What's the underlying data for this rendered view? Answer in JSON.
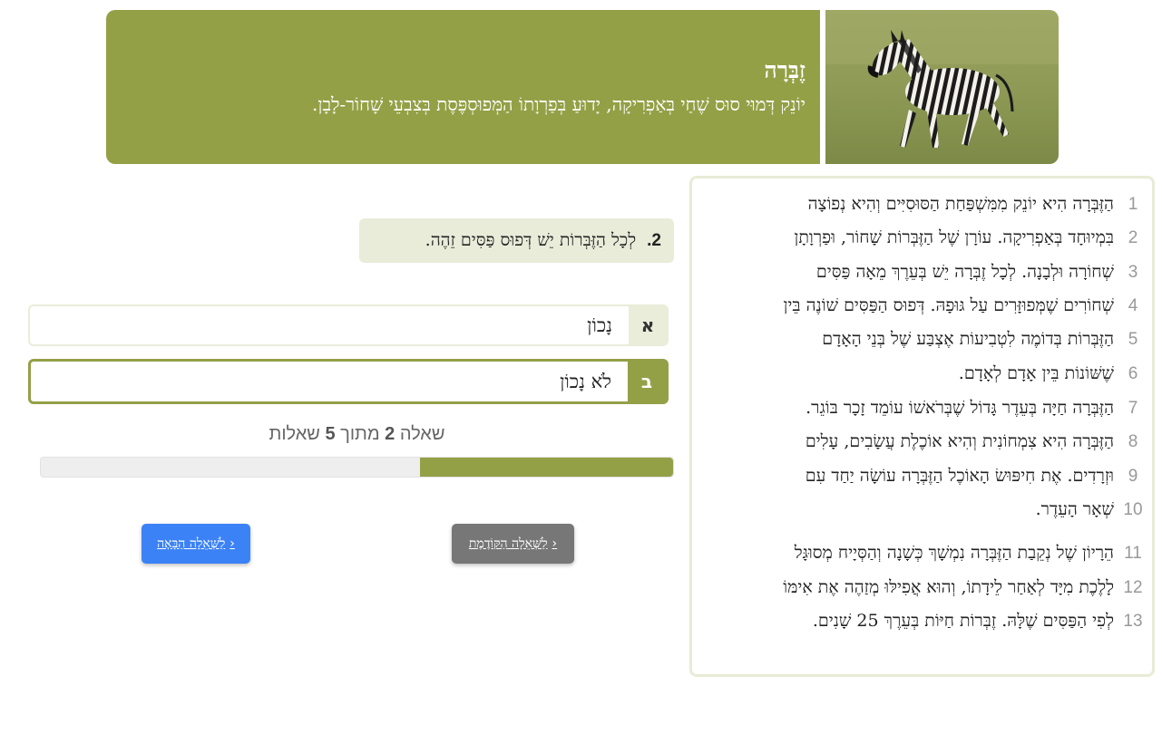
{
  "header": {
    "title": "זֶבְּרָה",
    "subtitle": "יוֹנֵק דְּמוּי סוּס שֶׁחַי בְּאַפְרִיקָה, יָדוּעַ בְּפַרְוָתוֹ הַמְּפוּסְפֶּסֶת בְּצִבְעֵי שָׁחוֹר-לָבָן.",
    "image_alt": "zebra-photo"
  },
  "passage": {
    "lines": [
      {
        "num": "1",
        "text": "הַזֶּבְּרָה הִיא יוֹנֵק מִמִּשְׁפַּחַת הַסּוּסִיִּים וְהִיא נְפוֹצָה"
      },
      {
        "num": "2",
        "text": "בִּמְיוּחָד בְּאַפְרִיקָה. עוֹרָן שֶׁל הַזֶּבְּרוֹת שָׁחוֹר, וּפַרְוָתָן"
      },
      {
        "num": "3",
        "text": "שְׁחוֹרָה וּלְבָנָה. לְכָל זֶבְּרָה יֵשׁ בְּעֵרֶךְ מֵאָה פַּסִּים"
      },
      {
        "num": "4",
        "text": "שְׁחוֹרִים שֶׁמְּפוּזָּרִים עַל גּוּפָהּ. דְּפוּס הַפַּסִּים שׁוֹנֶה בֵּין"
      },
      {
        "num": "5",
        "text": "הַזֶּבְּרוֹת בְּדוֹמֶה לִטְבִיעוֹת אֶצְבַּע שֶׁל בְּנֵי הָאָדָם"
      },
      {
        "num": "6",
        "text": "שֶׁשּׁוֹנוֹת בֵּין אָדָם לְאָדָם."
      },
      {
        "num": "7",
        "text": "הַזֶּבְּרָה חַיָּה בְּעֵדֶר גָּדוֹל שֶׁבְּרֹאשׁוֹ עוֹמֵד זָכָר בּוֹגֵר."
      },
      {
        "num": "8",
        "text": "הַזֶּבְּרָה הִיא צִמְחוֹנִית וְהִיא אוֹכֶלֶת עֲשָׂבִים, עָלִים"
      },
      {
        "num": "9",
        "text": "וּזְרָדִים. אֶת חִיפּוּשׂ הָאוֹכֶל הַזֶּבְּרָה עוֹשָׂה יַחַד עִם"
      },
      {
        "num": "10",
        "text": "שְׁאָר הָעֵדֶר."
      },
      {
        "num": "11",
        "text": "הֵרָיוֹן שֶׁל נְקֵבַת הַזֶּבְּרָה נִמְשָׁךְ כְּשָׁנָה וְהַסְּיָיח מְסוּגָּל"
      },
      {
        "num": "12",
        "text": "לָלֶכֶת מִיָּד לְאַחַר לֵידָתוֹ, וְהוּא אֲפִילּוּ מְזַהֶה אֶת אִימּוֹ"
      },
      {
        "num": "13",
        "text": "לְפִי הַפַּסִּים שֶׁלָּהּ. זֶבְּרוֹת חַיּוֹת בְּעֵרֶךְ 25 שָׁנִים."
      }
    ]
  },
  "question": {
    "number": "2.",
    "text": "לְכָל הַזֶּבְּרוֹת יֵשׁ דְּפוּס פַּסִּים זֵהֶה."
  },
  "answers": [
    {
      "letter": "א",
      "text": "נָכוֹן",
      "selected": false
    },
    {
      "letter": "ב",
      "text": "לֹא נָכוֹן",
      "selected": true
    }
  ],
  "progress": {
    "prefix": "שאלה",
    "current": "2",
    "middle": "מתוך",
    "total": "5",
    "suffix": "שאלות",
    "fraction": 0.4
  },
  "navigation": {
    "next_label": "לַשְּׁאֵלָה הַבָּאָה",
    "prev_label": "לַשְּׁאֵלָה הַקּוֹדֶמֶת",
    "chevron": "‹"
  },
  "colors": {
    "accent": "#94a046",
    "accent_light": "#e8ecd9",
    "next_button": "#3b82f6",
    "prev_button": "#777777"
  }
}
